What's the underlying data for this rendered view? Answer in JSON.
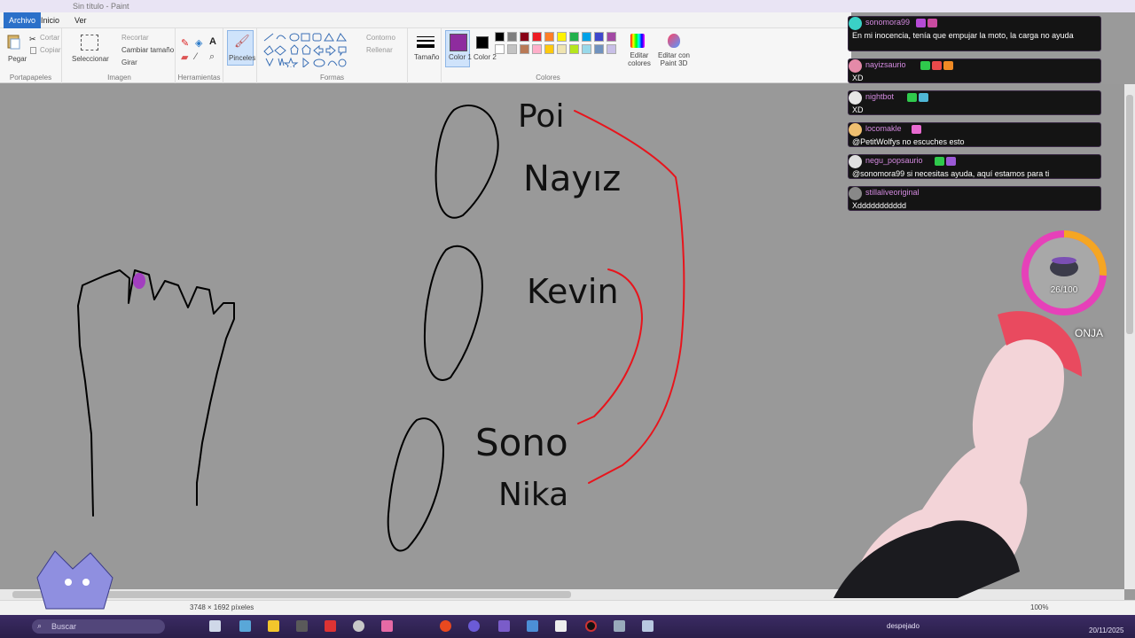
{
  "window": {
    "title": "Sin título - Paint"
  },
  "menu": {
    "tabs": [
      "Archivo",
      "Inicio",
      "Ver"
    ],
    "active": "Archivo"
  },
  "ribbon": {
    "clipboard": {
      "paste": "Pegar",
      "cut": "Cortar",
      "copy": "Copiar",
      "label": "Portapapeles"
    },
    "image": {
      "select": "Seleccionar",
      "crop": "Recortar",
      "resize": "Cambiar tamaño",
      "rotate": "Girar",
      "label": "Imagen"
    },
    "tools": {
      "label": "Herramientas"
    },
    "brushes": {
      "label": "Pinceles"
    },
    "shapes": {
      "outline": "Contorno",
      "fill": "Rellenar",
      "label": "Formas"
    },
    "size": {
      "label": "Tamaño"
    },
    "colors": {
      "color1": "Color 1",
      "color2": "Color 2",
      "edit": "Editar colores",
      "paint3d": "Editar con Paint 3D",
      "label": "Colores",
      "color1_value": "#8e2c9e",
      "palette_row1": [
        "#000000",
        "#7f7f7f",
        "#880015",
        "#ed1c24",
        "#ff7f27",
        "#fff200",
        "#22b14c",
        "#00a2e8",
        "#3f48cc",
        "#a349a4"
      ],
      "palette_row2": [
        "#ffffff",
        "#c3c3c3",
        "#b97a57",
        "#ffaec9",
        "#ffc90e",
        "#efe4b0",
        "#b5e61d",
        "#99d9ea",
        "#7092be",
        "#c8bfe7"
      ]
    }
  },
  "drawing": {
    "names": [
      "Poi",
      "Nayız",
      "Kevin",
      "Sono",
      "Nika"
    ],
    "stroke_color": "#000000",
    "connector_color": "#e8141c",
    "dot_color": "#a23fbf"
  },
  "statusbar": {
    "dimensions": "3748 × 1692 píxeles",
    "zoom": "100%"
  },
  "taskbar": {
    "search_placeholder": "Buscar",
    "weather": "despejado",
    "date": "20/11/2025"
  },
  "chat": [
    {
      "user": "sonomora99",
      "text": "En mi inocencia, tenía que empujar la moto, la carga no ayuda",
      "user_color": "#d48ae0"
    },
    {
      "user": "nayizsaurio",
      "text": "XD",
      "user_color": "#d48ae0"
    },
    {
      "user": "nightbot",
      "text": "XD",
      "user_color": "#d48ae0"
    },
    {
      "user": "locomakle",
      "text": "@PetitWolfys no escuches esto",
      "user_color": "#d48ae0"
    },
    {
      "user": "negu_popsaurio",
      "text": "@sonomora99 si necesitas ayuda, aquí estamos para ti",
      "user_color": "#d48ae0"
    },
    {
      "user": "stillaliveoriginal",
      "text": "Xddddddddddd",
      "user_color": "#d48ae0"
    }
  ],
  "goal": {
    "value": "26/100",
    "progress": 0.26,
    "label": "ONJA"
  }
}
